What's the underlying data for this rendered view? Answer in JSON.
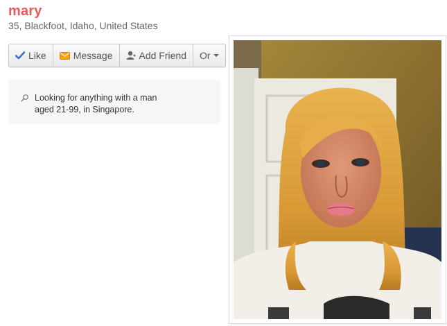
{
  "profile": {
    "name": "mary",
    "location": "35, Blackfoot, Idaho, United States"
  },
  "actions": {
    "like_label": "Like",
    "message_label": "Message",
    "add_friend_label": "Add Friend",
    "or_label": "Or"
  },
  "looking_for": {
    "text": "Looking for anything with a man aged 21-99, in Singapore."
  },
  "colors": {
    "name": "#ea5a5a",
    "like_check": "#3b6fc6",
    "message_envelope": "#f2a31b"
  },
  "icons": {
    "like": "check-icon",
    "message": "envelope-icon",
    "add_friend": "person-plus-icon",
    "or": "caret-down-icon",
    "looking_for": "search-icon"
  }
}
